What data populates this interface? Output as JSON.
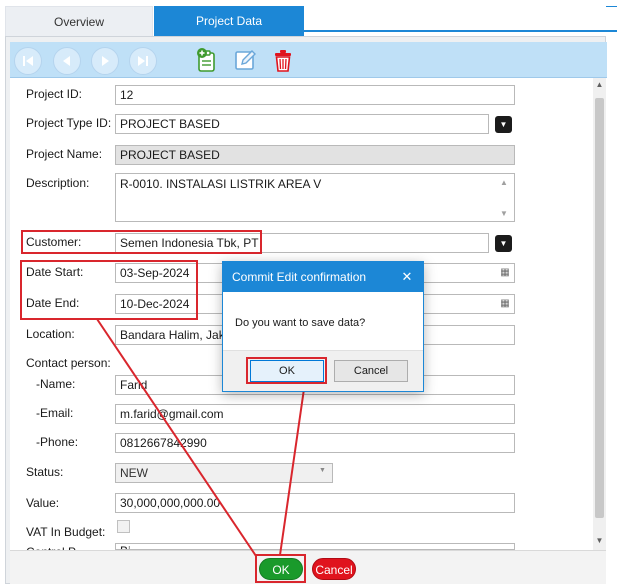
{
  "tabs": [
    {
      "label": "Overview"
    },
    {
      "label": "Project Data"
    }
  ],
  "toolbar": {
    "icons": [
      "first-record-icon",
      "previous-record-icon",
      "next-record-icon",
      "last-record-icon",
      "add-record-icon",
      "edit-record-icon",
      "delete-record-icon"
    ]
  },
  "form": {
    "project_id": {
      "label": "Project ID:",
      "value": "12"
    },
    "project_type_id": {
      "label": "Project Type ID:",
      "value": "PROJECT BASED"
    },
    "project_name": {
      "label": "Project Name:",
      "value": "PROJECT BASED"
    },
    "description": {
      "label": "Description:",
      "value": "R-0010. INSTALASI LISTRIK AREA V"
    },
    "customer": {
      "label": "Customer:",
      "value": "Semen Indonesia Tbk, PT"
    },
    "date_start": {
      "label": "Date Start:",
      "value": "03-Sep-2024"
    },
    "date_end": {
      "label": "Date End:",
      "value": "10-Dec-2024"
    },
    "location": {
      "label": "Location:",
      "value": "Bandara Halim, Jaka"
    },
    "contact_person": {
      "label": "Contact person:"
    },
    "contact_name": {
      "label": "-Name:",
      "value": "Farid"
    },
    "contact_email": {
      "label": "-Email:",
      "value": "m.farid@gmail.com"
    },
    "contact_phone": {
      "label": "-Phone:",
      "value": "0812667842990"
    },
    "status": {
      "label": "Status:",
      "value": "NEW"
    },
    "value": {
      "label": "Value:",
      "value": "30,000,000,000.00"
    },
    "vat_in_budget": {
      "label": "VAT In Budget:",
      "checked": false
    },
    "partial_label": "Control P",
    "partial_value": "Bi"
  },
  "footer": {
    "ok_label": "OK",
    "cancel_label": "Cancel"
  },
  "dialog": {
    "title": "Commit Edit confirmation",
    "close_glyph": "✕",
    "message": "Do you want to save data?",
    "ok_label": "OK",
    "cancel_label": "Cancel"
  },
  "colors": {
    "accent": "#1c87d6",
    "annotation": "#d9262d",
    "ok_green": "#1a9a2b",
    "cancel_red": "#e0131d"
  }
}
